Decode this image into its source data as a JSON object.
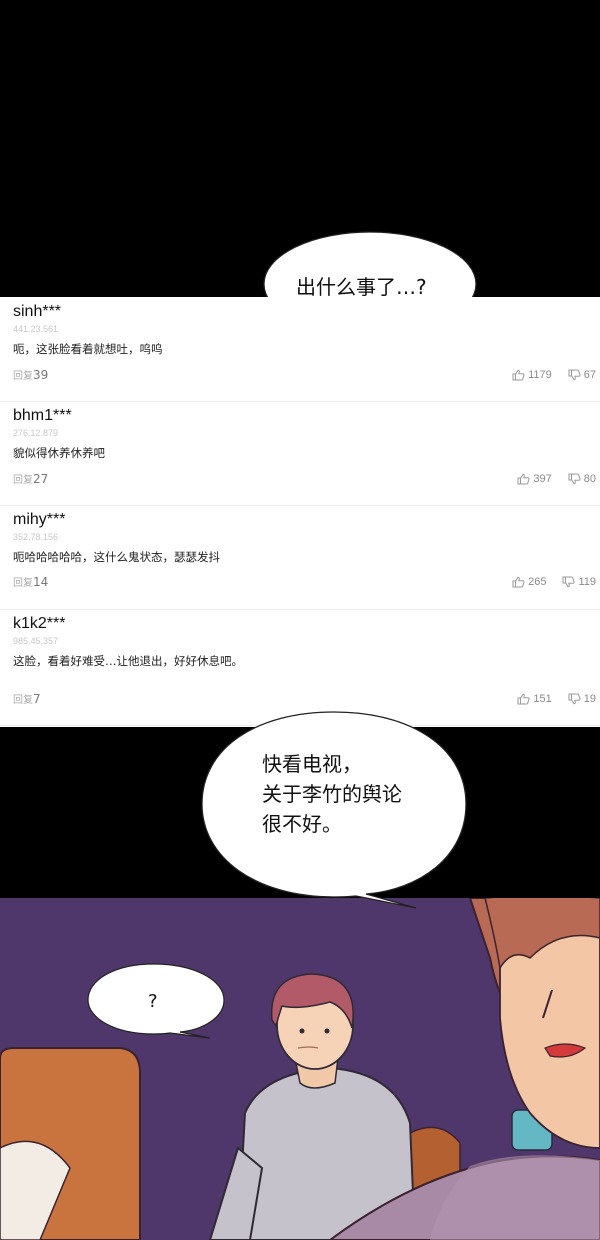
{
  "bubbles": {
    "top": "出什么事了…?",
    "middle_line1": "快看电视，",
    "middle_line2": "关于李竹的舆论",
    "middle_line3": "很不好。",
    "small": "?"
  },
  "comments": [
    {
      "user": "sinh***",
      "id": "441.23.561",
      "text": "呃，这张脸看着就想吐，呜呜",
      "reply_label": "回复",
      "replies": "39",
      "likes": "1179",
      "dislikes": "67"
    },
    {
      "user": "bhm1***",
      "id": "276.12.879",
      "text": "貌似得休养休养吧",
      "reply_label": "回复",
      "replies": "27",
      "likes": "397",
      "dislikes": "80"
    },
    {
      "user": "mihy***",
      "id": "352.78.156",
      "text": "呃哈哈哈哈哈，这什么鬼状态，瑟瑟发抖",
      "reply_label": "回复",
      "replies": "14",
      "likes": "265",
      "dislikes": "119"
    },
    {
      "user": "k1k2***",
      "id": "985.45.357",
      "text": "这脸，看着好难受…让他退出，好好休息吧。",
      "reply_label": "回复",
      "replies": "7",
      "likes": "151",
      "dislikes": "19"
    }
  ],
  "colors": {
    "background_scene": "#4d3568",
    "comment_panel": "#ffffff",
    "panel_black": "#000000"
  },
  "icons": [
    "thumbs-up-icon",
    "thumbs-down-icon"
  ]
}
